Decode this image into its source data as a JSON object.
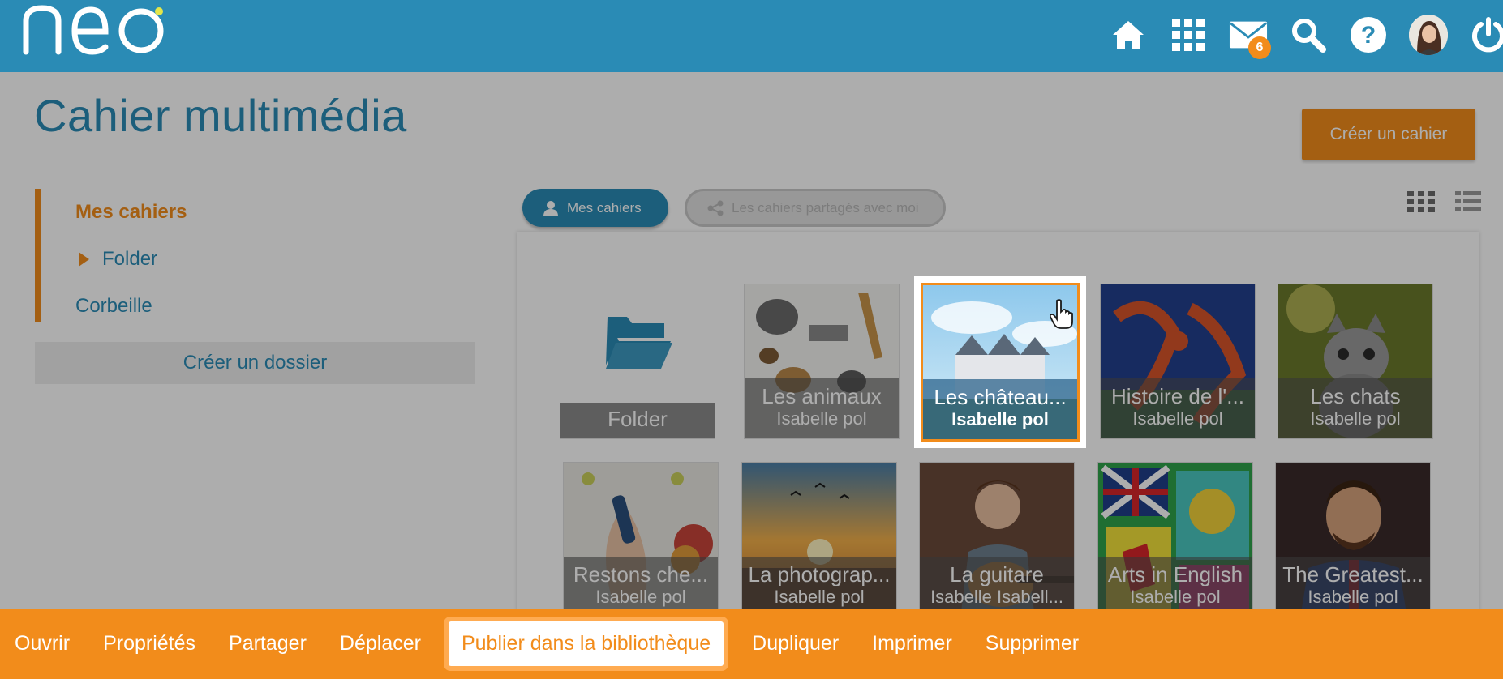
{
  "app": {
    "logo_text": "neo",
    "colors": {
      "primary": "#2a8bb5",
      "accent": "#f28c1b",
      "overlay": "rgba(0,0,0,0.32)"
    }
  },
  "header": {
    "icons": [
      "home-icon",
      "apps-grid-icon",
      "mail-icon",
      "search-icon",
      "help-icon",
      "avatar",
      "power-icon"
    ],
    "mail_badge": "6"
  },
  "page": {
    "title": "Cahier multimédia",
    "create_notebook_label": "Créer un cahier"
  },
  "sidebar": {
    "items": [
      {
        "label": "Mes cahiers",
        "active": true
      },
      {
        "label": "Folder",
        "has_caret": true
      },
      {
        "label": "Corbeille"
      }
    ],
    "create_folder_label": "Créer un dossier"
  },
  "tabs": [
    {
      "label": "Mes cahiers",
      "icon": "user-icon",
      "active": true
    },
    {
      "label": "Les cahiers partagés avec moi",
      "icon": "share-icon",
      "active": false
    }
  ],
  "view_modes": [
    "grid-view-icon",
    "list-view-icon"
  ],
  "cards": [
    {
      "title": "Folder",
      "owner": "",
      "type": "folder"
    },
    {
      "title": "Les animaux",
      "owner": "Isabelle pol",
      "type": "notebook"
    },
    {
      "title": "Les château...",
      "owner": "Isabelle pol",
      "type": "notebook",
      "selected": true
    },
    {
      "title": "Histoire de l'...",
      "owner": "Isabelle pol",
      "type": "notebook"
    },
    {
      "title": "Les chats",
      "owner": "Isabelle pol",
      "type": "notebook"
    },
    {
      "title": "Restons che...",
      "owner": "Isabelle pol",
      "type": "notebook"
    },
    {
      "title": "La photograp...",
      "owner": "Isabelle pol",
      "type": "notebook"
    },
    {
      "title": "La guitare",
      "owner": "Isabelle Isabell...",
      "type": "notebook"
    },
    {
      "title": "Arts in English",
      "owner": "Isabelle pol",
      "type": "notebook"
    },
    {
      "title": "The Greatest...",
      "owner": "Isabelle pol",
      "type": "notebook"
    }
  ],
  "toolbar": {
    "actions": [
      "Ouvrir",
      "Propriétés",
      "Partager",
      "Déplacer",
      "Publier dans la bibliothèque",
      "Dupliquer",
      "Imprimer",
      "Supprimer"
    ],
    "highlighted": "Publier dans la bibliothèque"
  }
}
